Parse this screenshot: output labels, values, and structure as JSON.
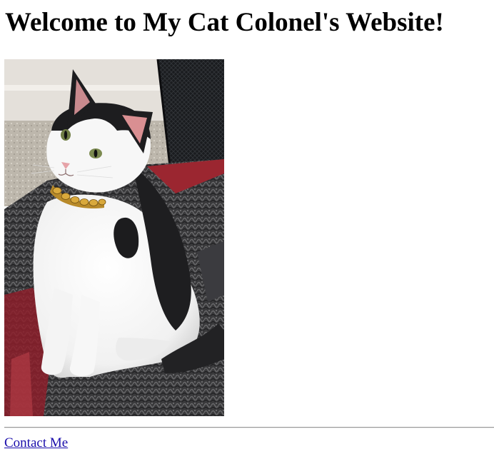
{
  "page": {
    "title": "Welcome to My Cat Colonel's Website!"
  },
  "photo": {
    "subject": "cat-photo"
  },
  "footer": {
    "contact_label": "Contact Me"
  },
  "colors": {
    "link": "#1a0dab",
    "text": "#000000",
    "divider": "#9a9a9a"
  }
}
